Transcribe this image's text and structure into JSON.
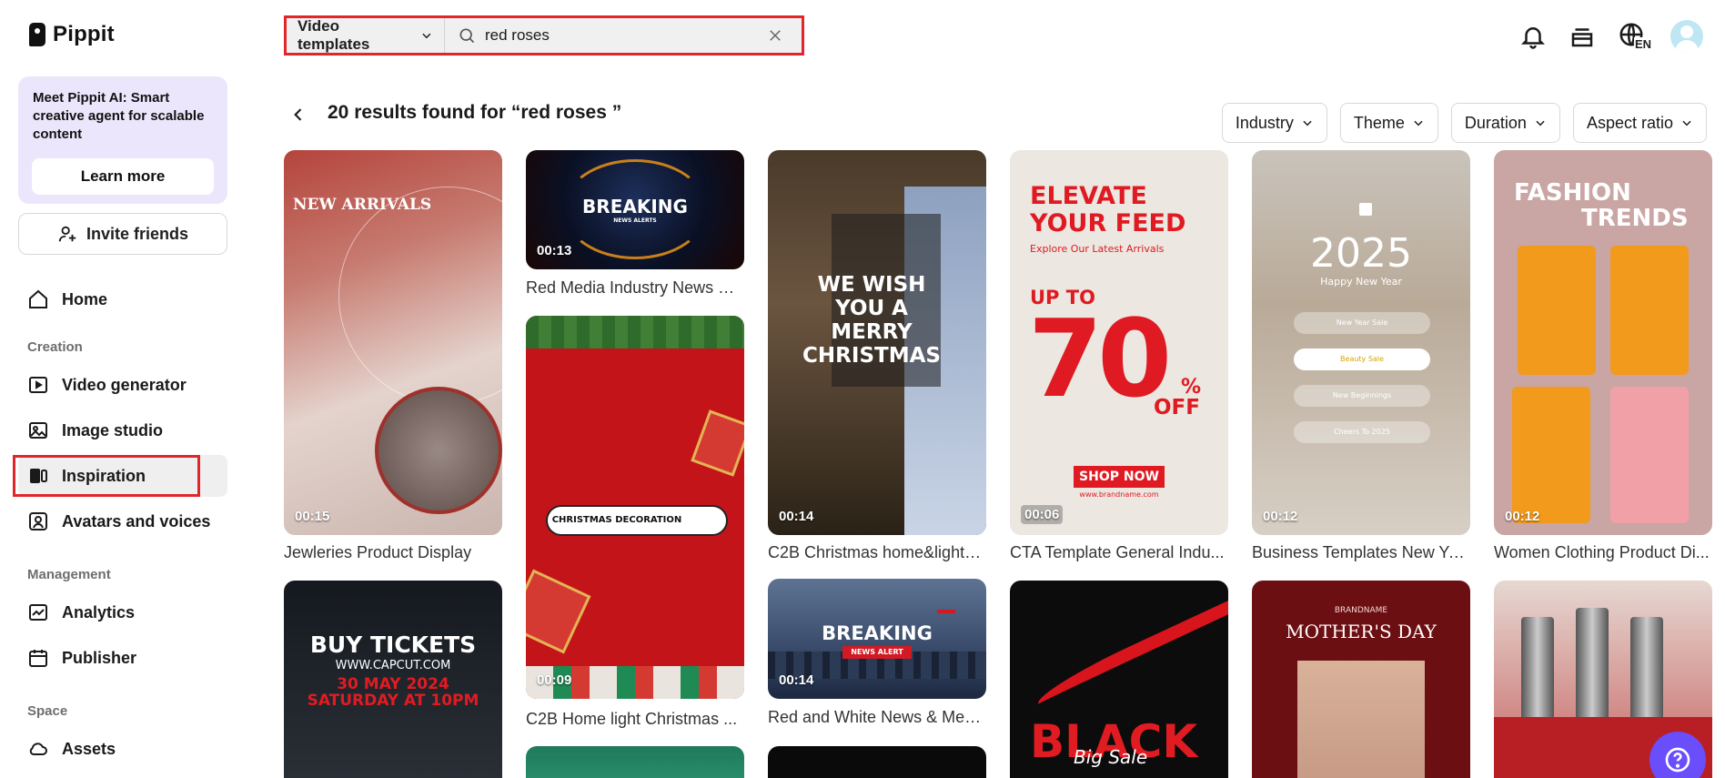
{
  "brand": {
    "name": "Pippit"
  },
  "sidebar": {
    "promo_text": "Meet Pippit AI: Smart creative agent for scalable content",
    "promo_button": "Learn more",
    "invite_label": "Invite friends",
    "home": "Home",
    "section_creation": "Creation",
    "video_generator": "Video generator",
    "image_studio": "Image studio",
    "inspiration": "Inspiration",
    "avatars": "Avatars and voices",
    "section_management": "Management",
    "analytics": "Analytics",
    "publisher": "Publisher",
    "section_space": "Space",
    "assets": "Assets"
  },
  "search": {
    "type_label": "Video templates",
    "query": "red roses",
    "placeholder": "Search"
  },
  "topbar": {
    "language": "EN"
  },
  "results": {
    "title": "20 results found for “red roses ”",
    "filters": [
      "Industry",
      "Theme",
      "Duration",
      "Aspect ratio"
    ]
  },
  "cards": [
    {
      "title": "Jewleries Product Display",
      "duration": "00:15",
      "overlay": "NEW ARRIVALS"
    },
    {
      "title": "Red Media Industry News O...",
      "duration": "00:13",
      "overlay": "BREAKING",
      "overlay2": "NEWS ALERTS"
    },
    {
      "title": "C2B Home light Christmas ...",
      "duration": "00:09",
      "overlay": "CHRISTMAS DECORATION"
    },
    {
      "title": "C2B Christmas home&lights...",
      "duration": "00:14",
      "overlay": "WE WISH YOU A MERRY CHRISTMAS"
    },
    {
      "title": "Red and White News & Med...",
      "duration": "00:14",
      "overlay": "BREAKING",
      "overlay2": "NEWS ALERT"
    },
    {
      "title": "CTA Template General Indu...",
      "duration": "00:06",
      "overlay": "ELEVATE YOUR FEED",
      "overlay2": "Explore Our Latest Arrivals",
      "overlay3": "UP TO",
      "overlay4": "70",
      "overlay5": "%",
      "overlay6": "OFF",
      "overlay7": "SHOP NOW",
      "overlay8": "www.brandname.com"
    },
    {
      "title": "Business Templates New Ye...",
      "duration": "00:12",
      "overlay": "2025",
      "overlay2": "Happy New Year",
      "items": [
        "New Year Sale",
        "Beauty Sale",
        "New Beginnings",
        "Cheers To 2025"
      ]
    },
    {
      "title": "Women Clothing Product Di...",
      "duration": "00:12",
      "overlay": "FASHION",
      "overlay2": "TRENDS"
    },
    {
      "title": "",
      "duration": "",
      "overlay": "BUY TICKETS",
      "overlay2": "WWW.CAPCUT.COM",
      "overlay3": "30 MAY 2024",
      "overlay4": "SATURDAY AT 10PM"
    },
    {
      "title": "",
      "duration": "",
      "overlay": "BLACK",
      "overlay2": "Big Sale"
    },
    {
      "title": "",
      "duration": "",
      "overlay": "BRANDNAME",
      "overlay2": "MOTHER'S DAY"
    }
  ]
}
